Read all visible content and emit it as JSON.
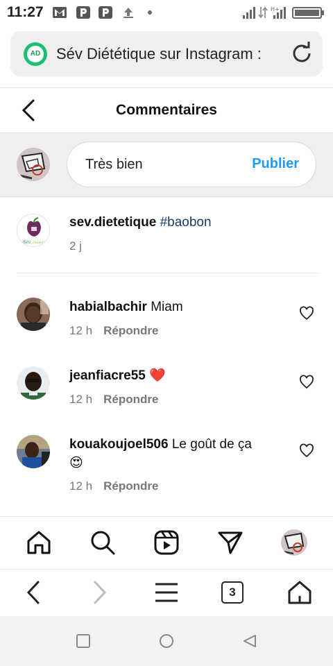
{
  "status_bar": {
    "time": "11:27",
    "notification_icons": [
      "gmail-icon",
      "parking-icon",
      "parking-icon",
      "upload-icon",
      "dot-icon"
    ],
    "right_icons": [
      "signal-icon",
      "data-arrows-icon",
      "hplus-signal-icon",
      "battery-icon"
    ]
  },
  "url_bar": {
    "badge_text": "AD",
    "title": "Sév Diététique sur Instagram : ",
    "reload_icon": "reload-icon"
  },
  "header": {
    "title": "Commentaires",
    "back_icon": "chevron-left-icon"
  },
  "composer": {
    "text": "Très bien",
    "publish_label": "Publier"
  },
  "caption": {
    "username": "sev.dietetique",
    "hashtag": "#baobon",
    "time": "2 j"
  },
  "comments": [
    {
      "username": "habialbachir",
      "text": "Miam",
      "emoji": "",
      "time": "12 h",
      "reply_label": "Répondre"
    },
    {
      "username": "jeanfiacre55",
      "text": "",
      "emoji": "❤️",
      "time": "12 h",
      "reply_label": "Répondre"
    },
    {
      "username": "kouakoujoel506",
      "text": "Le goût de ça",
      "emoji": "😍",
      "time": "12 h",
      "reply_label": "Répondre"
    }
  ],
  "bottom_nav": [
    "home-icon",
    "search-icon",
    "reels-icon",
    "direct-icon",
    "profile-avatar"
  ],
  "browser_bar": {
    "items": [
      "back-icon",
      "forward-icon",
      "menu-icon",
      "tabs-icon",
      "home-icon"
    ],
    "tab_count": "3"
  },
  "android_nav": [
    "recents-icon",
    "home-circle-icon",
    "back-triangle-icon"
  ],
  "colors": {
    "accent": "#1d9bf0",
    "hashtag": "#1b3c6f",
    "heart": "#e0213c",
    "badge": "#1dbf73"
  }
}
